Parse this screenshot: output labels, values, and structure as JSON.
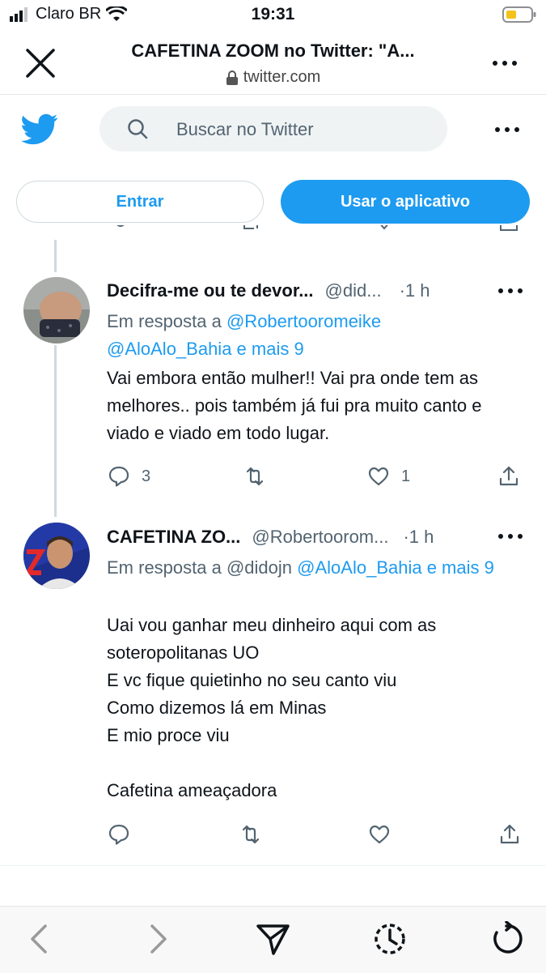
{
  "status_bar": {
    "carrier": "Claro BR",
    "time": "19:31"
  },
  "browser": {
    "title": "CAFETINA ZOOM no Twitter: \"A...",
    "domain": "twitter.com"
  },
  "twitter": {
    "search_placeholder": "Buscar no Twitter",
    "login_label": "Entrar",
    "app_label": "Usar o aplicativo"
  },
  "tweets": [
    {
      "name": "Decifra-me ou te devor...",
      "handle": "@did...",
      "time": "1 h",
      "reply_prefix": "Em resposta a",
      "reply_to": "@Robertooromeike @AloAlo_Bahia e mais 9",
      "text": "Vai embora então mulher!! Vai pra onde tem as melhores.. pois também já fui pra muito canto e viado e viado em todo lugar.",
      "replies": "3",
      "retweets": "",
      "likes": "1"
    },
    {
      "name": "CAFETINA ZO...",
      "handle": "@Robertoorom...",
      "time": "1 h",
      "reply_prefix": "Em resposta a",
      "reply_plain": "@didojn",
      "reply_to": "@AloAlo_Bahia e mais 9",
      "text": "Uai vou ganhar meu dinheiro aqui com as soteropolitanas UO\nE vc fique quietinho no seu canto viu\nComo dizemos lá em Minas\nE mio proce viu\n\nCafetina ameaçadora",
      "replies": "",
      "retweets": "",
      "likes": ""
    }
  ],
  "colors": {
    "accent": "#1d9bf0",
    "muted": "#536471",
    "text": "#0f1419"
  },
  "icons": [
    "close-icon",
    "lock-icon",
    "more-icon",
    "twitter-bird-icon",
    "search-icon",
    "reply-icon",
    "retweet-icon",
    "like-icon",
    "share-icon",
    "back-icon",
    "forward-icon",
    "send-icon",
    "history-icon",
    "reload-icon"
  ]
}
